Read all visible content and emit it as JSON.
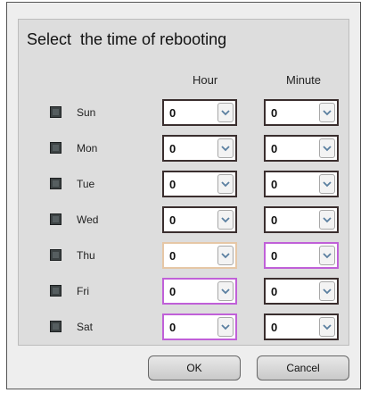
{
  "dialog": {
    "title": "Select  the time of rebooting",
    "columns": {
      "hour": "Hour",
      "minute": "Minute"
    },
    "icons": {
      "checkbox": "checkbox-icon",
      "dropdown": "chevron-down-icon"
    },
    "rows": [
      {
        "day": "Sun",
        "hour": "0",
        "minute": "0"
      },
      {
        "day": "Mon",
        "hour": "0",
        "minute": "0"
      },
      {
        "day": "Tue",
        "hour": "0",
        "minute": "0"
      },
      {
        "day": "Wed",
        "hour": "0",
        "minute": "0"
      },
      {
        "day": "Thu",
        "hour": "0",
        "minute": "0"
      },
      {
        "day": "Fri",
        "hour": "0",
        "minute": "0"
      },
      {
        "day": "Sat",
        "hour": "0",
        "minute": "0"
      }
    ],
    "buttons": {
      "ok": "OK",
      "cancel": "Cancel"
    },
    "colors": {
      "panel_bg": "#dddddd",
      "highlight_orange": "#e6c7a6",
      "highlight_purple": "#c060d8"
    }
  }
}
